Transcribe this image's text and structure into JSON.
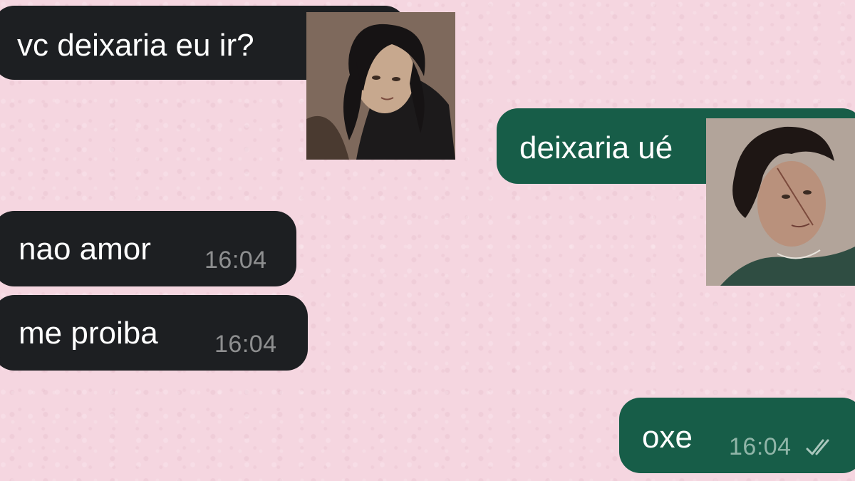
{
  "messages": [
    {
      "direction": "incoming",
      "text": "vc deixaria eu ir?"
    },
    {
      "direction": "outgoing",
      "text": "deixaria ué"
    },
    {
      "direction": "incoming",
      "text": "nao amor",
      "time": "16:04"
    },
    {
      "direction": "incoming",
      "text": "me proiba",
      "time": "16:04"
    },
    {
      "direction": "outgoing",
      "text": "oxe",
      "time": "16:04",
      "status_icon": "double-check-icon"
    }
  ],
  "avatars": [
    {
      "name": "avatar-long-dark-hair",
      "icon": "person-illustration"
    },
    {
      "name": "avatar-curly-hair",
      "icon": "person-illustration"
    }
  ],
  "colors": {
    "background": "#f5d6e0",
    "incoming_bubble": "#1d1f22",
    "outgoing_bubble": "#175d48",
    "text": "#ffffff"
  }
}
